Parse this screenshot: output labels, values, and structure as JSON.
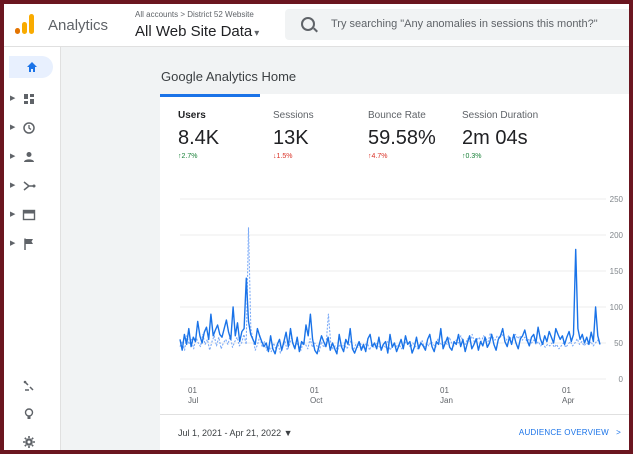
{
  "app": {
    "title": "Analytics"
  },
  "account": {
    "breadcrumb": "All accounts > District 52 Website",
    "view": "All Web Site Data"
  },
  "search": {
    "placeholder": "Try searching \"Any anomalies in sessions this month?\""
  },
  "nav": {
    "top": [
      "home-icon",
      "dashboard-icon",
      "clock-icon",
      "person-icon",
      "acquisition-icon",
      "behavior-icon",
      "flag-icon"
    ],
    "bottom": [
      "attribution-icon",
      "discover-icon",
      "settings-icon"
    ]
  },
  "page": {
    "title": "Google Analytics Home"
  },
  "metrics": [
    {
      "label": "Users",
      "value": "8.4K",
      "change": "↑2.7%",
      "direction": "up"
    },
    {
      "label": "Sessions",
      "value": "13K",
      "change": "↓1.5%",
      "direction": "down"
    },
    {
      "label": "Bounce Rate",
      "value": "59.58%",
      "change": "↑4.7%",
      "direction": "down"
    },
    {
      "label": "Session Duration",
      "value": "2m 04s",
      "change": "↑0.3%",
      "direction": "up"
    }
  ],
  "chart_data": {
    "type": "line",
    "x_ticks": [
      {
        "day": "01",
        "month": "Jul"
      },
      {
        "day": "01",
        "month": "Oct"
      },
      {
        "day": "01",
        "month": "Jan"
      },
      {
        "day": "01",
        "month": "Apr"
      }
    ],
    "y_ticks": [
      250,
      200,
      150,
      100,
      50,
      0
    ],
    "ylim": [
      0,
      250
    ],
    "x": [
      "2021-07-01",
      "2022-04-21"
    ],
    "series": [
      {
        "style": "solid",
        "color": "#1a73e8",
        "values": [
          55,
          40,
          62,
          48,
          70,
          45,
          58,
          52,
          80,
          60,
          50,
          65,
          72,
          55,
          90,
          60,
          68,
          75,
          62,
          58,
          70,
          82,
          65,
          55,
          100,
          60,
          78,
          52,
          66,
          70,
          140,
          80,
          62,
          55,
          48,
          70,
          60,
          52,
          45,
          50,
          38,
          60,
          42,
          35,
          48,
          55,
          40,
          52,
          65,
          45,
          70,
          50,
          42,
          58,
          38,
          52,
          48,
          75,
          60,
          90,
          55,
          40,
          35,
          48,
          60,
          52,
          45,
          58,
          40,
          50,
          42,
          35,
          62,
          45,
          38,
          55,
          48,
          70,
          42,
          36,
          44,
          52,
          40,
          48,
          38,
          56,
          62,
          45,
          50,
          42,
          58,
          40,
          48,
          52,
          36,
          62,
          44,
          50,
          38,
          46,
          55,
          42,
          60,
          48,
          52,
          36,
          44,
          58,
          42,
          50,
          46,
          40,
          55,
          62,
          45,
          38,
          52,
          48,
          70,
          42,
          50,
          58,
          44,
          40,
          52,
          48,
          62,
          45,
          55,
          38,
          50,
          60,
          42,
          48,
          56,
          40,
          52,
          46,
          58,
          44,
          50,
          62,
          48,
          40,
          55,
          60,
          70,
          52,
          45,
          58,
          48,
          62,
          50,
          42,
          56,
          60,
          68,
          54,
          46,
          58,
          62,
          50,
          72,
          56,
          48,
          60,
          52,
          66,
          58,
          50,
          70,
          62,
          55,
          60,
          48,
          58,
          66,
          52,
          62,
          180,
          70,
          55,
          62,
          50,
          58,
          48,
          65,
          52,
          100,
          60,
          48
        ]
      },
      {
        "style": "dashed",
        "color": "#7baaf7",
        "values": [
          45,
          52,
          40,
          60,
          48,
          55,
          42,
          58,
          50,
          45,
          62,
          48,
          55,
          40,
          52,
          60,
          46,
          58,
          42,
          50,
          55,
          48,
          60,
          44,
          52,
          58,
          46,
          50,
          62,
          48,
          210,
          70,
          55,
          40,
          48,
          60,
          44,
          52,
          40,
          46,
          38,
          50,
          42,
          48,
          36,
          44,
          52,
          40,
          48,
          58,
          44,
          50,
          46,
          40,
          52,
          48,
          42,
          56,
          44,
          50,
          46,
          38,
          52,
          44,
          48,
          90,
          50,
          42,
          46,
          40,
          48,
          44,
          50,
          42,
          46,
          54,
          40,
          48,
          44,
          50,
          42,
          46,
          52,
          40,
          48,
          44,
          50,
          46,
          42,
          48,
          44,
          52,
          40,
          46,
          50,
          44,
          48,
          42,
          46,
          52,
          48,
          44,
          50,
          46,
          42,
          48,
          54,
          44,
          50,
          46,
          52,
          48,
          44,
          56,
          50,
          46,
          52,
          48,
          58,
          50,
          46,
          54,
          50,
          60,
          52,
          48,
          56,
          52,
          62,
          50,
          54,
          58,
          52,
          60,
          56,
          52,
          64,
          58,
          54,
          60,
          56,
          62,
          58,
          54,
          60,
          56,
          58,
          62,
          56,
          60,
          54,
          58,
          52,
          56,
          50,
          54,
          48,
          52,
          46,
          50,
          44,
          48,
          46,
          50,
          44,
          48,
          42,
          46,
          50,
          44,
          48,
          52,
          46,
          50,
          56,
          48,
          52,
          46,
          50,
          48,
          52,
          46,
          50,
          54,
          48
        ]
      }
    ]
  },
  "footer": {
    "date_range": "Jul 1, 2021 - Apr 21, 2022",
    "date_caret": "▼",
    "audience_link": "AUDIENCE OVERVIEW",
    "audience_arrow": ">"
  }
}
